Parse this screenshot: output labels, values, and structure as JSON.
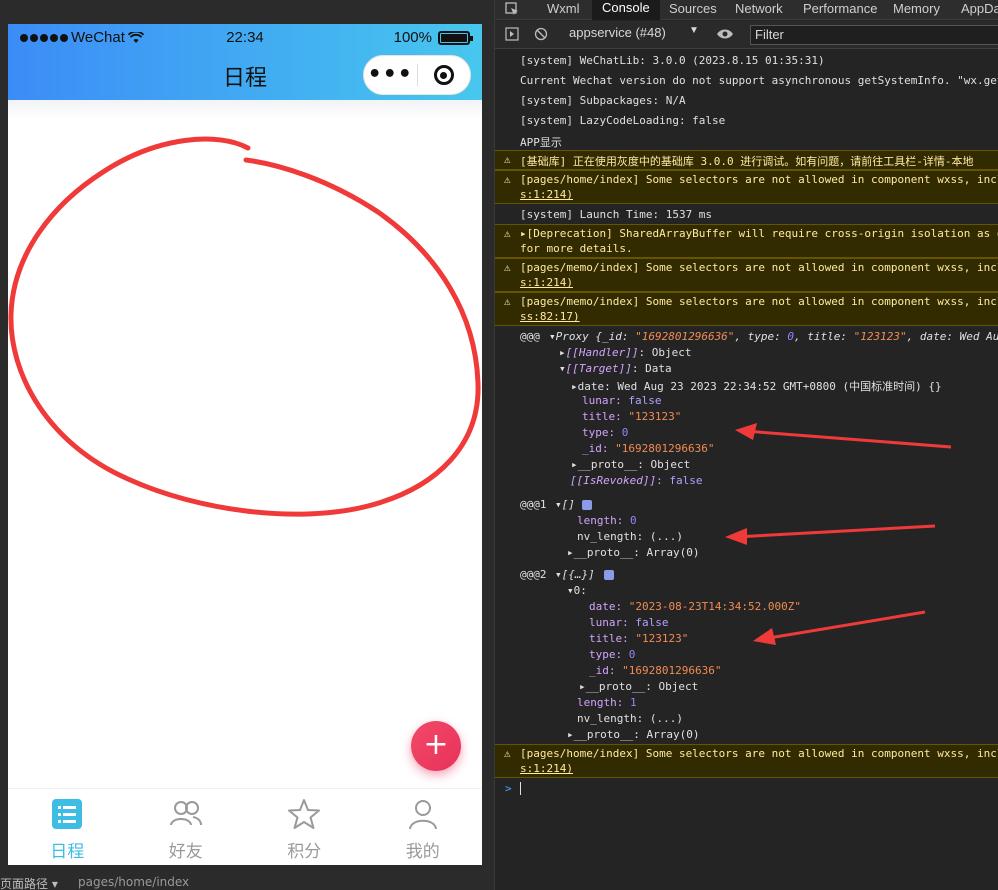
{
  "simulator": {
    "status_bar": {
      "carrier": "WeChat",
      "time": "22:34",
      "battery": "100%"
    },
    "page_title": "日程",
    "capsule": {
      "more": "•••"
    },
    "fab": "+",
    "tabs": [
      {
        "label": "日程",
        "icon": "schedule-list-icon",
        "active": true
      },
      {
        "label": "好友",
        "icon": "friends-icon",
        "active": false
      },
      {
        "label": "积分",
        "icon": "star-icon",
        "active": false
      },
      {
        "label": "我的",
        "icon": "profile-icon",
        "active": false
      }
    ],
    "footer": {
      "label": "页面路径 ▾",
      "path": "pages/home/index"
    },
    "colors": {
      "header_start": "#3c8cf7",
      "header_end": "#47c7ee",
      "active_tab": "#3dbde6",
      "fab": "#e8315a",
      "annotation": "#f03a3a"
    }
  },
  "devtools": {
    "tabs": [
      "Wxml",
      "Console",
      "Sources",
      "Network",
      "Performance",
      "Memory",
      "AppData"
    ],
    "active_tab": "Console",
    "context": "appservice (#48)",
    "filter_placeholder": "Filter",
    "lines": {
      "l1": "[system] WeChatLib: 3.0.0 (2023.8.15 01:35:31)",
      "l2": "Current Wechat version do not support asynchronous getSystemInfo. \"wx.getSy",
      "l3": "[system] Subpackages: N/A",
      "l4": "[system] LazyCodeLoading: false",
      "l5": "APP显示",
      "w1": "[基础库] 正在使用灰度中的基础库 3.0.0 进行调试。如有问题，请前往工具栏-详情-本地",
      "w2a": "[pages/home/index] Some selectors are not allowed in component wxss, inclu",
      "w2b": "s:1:214)",
      "l6": "[system] Launch Time: 1537 ms",
      "w3a": "▸[Deprecation] SharedArrayBuffer will require cross-origin isolation as o",
      "w3b": "for more details.",
      "w4a": "[pages/memo/index] Some selectors are not allowed in component wxss, inclu",
      "w4b": "s:1:214)",
      "w5a": "[pages/memo/index] Some selectors are not allowed in component wxss, inclu",
      "w5b": "ss:82:17)",
      "p_head_label": "@@@",
      "p_head_a": "▾Proxy {_id: ",
      "p_head_id": "\"1692801296636\"",
      "p_head_b": ", type: ",
      "p_head_type": "0",
      "p_head_c": ", title: ",
      "p_head_title": "\"123123\"",
      "p_head_d": ", date: Wed Aug",
      "p_handler_k": "[[Handler]]",
      "p_handler_v": ": Object",
      "p_target_k": "[[Target]]",
      "p_target_v": ": Data",
      "p_date": "date: Wed Aug 23 2023 22:34:52 GMT+0800 (中国标准时间) {}",
      "p_lunar_k": "lunar: ",
      "p_lunar_v": "false",
      "p_title_k": "title: ",
      "p_title_v": "\"123123\"",
      "p_type_k": "type: ",
      "p_type_v": "0",
      "p_id_k": "_id: ",
      "p_id_v": "\"1692801296636\"",
      "p_proto": "▸__proto__: Object",
      "p_revoked_k": "[[IsRevoked]]",
      "p_revoked_v": ": false",
      "a1_label": "@@@1",
      "a1_head": "▾[]",
      "a1_len_k": "length: ",
      "a1_len_v": "0",
      "a1_nv": "nv_length: (...)",
      "a1_proto": "▸__proto__: Array(0)",
      "a2_label": "@@@2",
      "a2_head": "▾[{…}]",
      "a2_0": "▾0:",
      "a2_date_k": "date: ",
      "a2_date_v": "\"2023-08-23T14:34:52.000Z\"",
      "a2_lunar_k": "lunar: ",
      "a2_lunar_v": "false",
      "a2_title_k": "title: ",
      "a2_title_v": "\"123123\"",
      "a2_type_k": "type: ",
      "a2_type_v": "0",
      "a2_id_k": "_id: ",
      "a2_id_v": "\"1692801296636\"",
      "a2_proto_obj": "▸__proto__: Object",
      "a2_len_k": "length: ",
      "a2_len_v": "1",
      "a2_nv": "nv_length: (...)",
      "a2_proto": "▸__proto__: Array(0)",
      "w6a": "[pages/home/index] Some selectors are not allowed in component wxss, inclu",
      "w6b": "s:1:214)",
      "prompt": ">"
    }
  }
}
